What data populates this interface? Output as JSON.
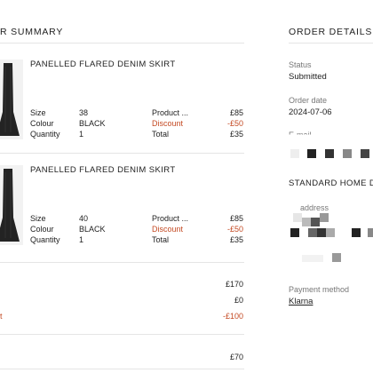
{
  "summary": {
    "title": "R SUMMARY"
  },
  "items": [
    {
      "name": "PANELLED FLARED DENIM SKIRT",
      "size_label": "Size",
      "size": "38",
      "colour_label": "Colour",
      "colour": "BLACK",
      "qty_label": "Quantity",
      "qty": "1",
      "price_label": "Product ...",
      "price": "£85",
      "discount_label": "Discount",
      "discount": "-£50",
      "total_label": "Total",
      "total": "£35"
    },
    {
      "name": "PANELLED FLARED DENIM SKIRT",
      "size_label": "Size",
      "size": "40",
      "colour_label": "Colour",
      "colour": "BLACK",
      "qty_label": "Quantity",
      "qty": "1",
      "price_label": "Product ...",
      "price": "£85",
      "discount_label": "Discount",
      "discount": "-£50",
      "total_label": "Total",
      "total": "£35"
    }
  ],
  "totals": {
    "subtotal": "£170",
    "shipping": "£0",
    "discount_label": "t",
    "discount": "-£100",
    "total": "£70"
  },
  "details": {
    "title": "ORDER DETAILS",
    "status_label": "Status",
    "status": "Submitted",
    "date_label": "Order date",
    "date": "2024-07-06",
    "email_label": "E-mail",
    "delivery_title": "STANDARD HOME DE",
    "address_label": "address",
    "payment_label": "Payment method",
    "payment": "Klarna"
  },
  "colors": {
    "accent_discount": "#c44a23",
    "divider": "#e5e5e5"
  }
}
